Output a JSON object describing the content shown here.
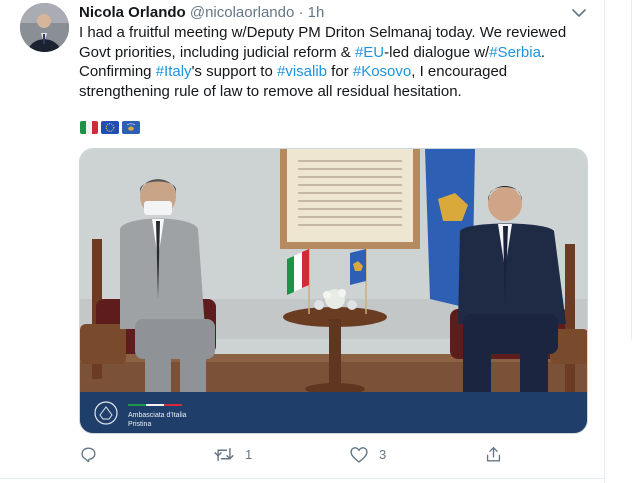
{
  "tweet": {
    "author_name": "Nicola Orlando",
    "author_handle": "@nicolaorlando",
    "separator": "·",
    "time": "1h",
    "text_parts": [
      {
        "text": "I had a fruitful meeting w/Deputy PM Driton Selmanaj today. We reviewed Govt priorities, including judicial reform & ",
        "tag": false
      },
      {
        "text": "#EU",
        "tag": true
      },
      {
        "text": "-led dialogue w/",
        "tag": false
      },
      {
        "text": "#Serbia",
        "tag": true
      },
      {
        "text": ". Confirming ",
        "tag": false
      },
      {
        "text": "#Italy",
        "tag": true
      },
      {
        "text": "'s support to ",
        "tag": false
      },
      {
        "text": "#visalib",
        "tag": true
      },
      {
        "text": " for ",
        "tag": false
      },
      {
        "text": "#Kosovo",
        "tag": true
      },
      {
        "text": ", I encouraged strengthening rule of law to remove all residual hesitation.",
        "tag": false
      }
    ],
    "flags": [
      "italy-flag-icon",
      "eu-flag-icon",
      "kosovo-flag-icon"
    ],
    "media": {
      "caption_line1": "Ambasciata d'Italia",
      "caption_line2": "Pristina",
      "colors": {
        "wall": "#ccd1d2",
        "floor": "#7a5236",
        "banner": "#1f3f6a",
        "chair": "#6e1f1f"
      }
    },
    "actions": {
      "reply": {
        "icon": "reply-icon",
        "count": ""
      },
      "retweet": {
        "icon": "retweet-icon",
        "count": "1"
      },
      "like": {
        "icon": "heart-icon",
        "count": "3"
      },
      "share": {
        "icon": "share-icon",
        "count": ""
      }
    },
    "colors": {
      "link": "#1b95e0",
      "muted": "#657786",
      "text": "#14171a"
    }
  }
}
